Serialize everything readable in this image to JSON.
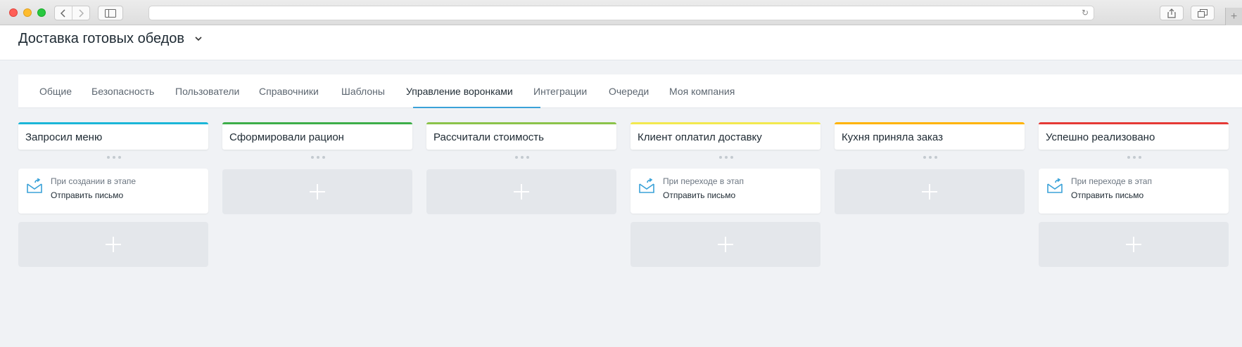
{
  "browser": {
    "buttons": [
      "back",
      "forward",
      "sidebar",
      "reload",
      "share",
      "tabs",
      "new-tab"
    ]
  },
  "app": {
    "title": "Доставка готовых обедов"
  },
  "tabs": [
    {
      "label": "Общие"
    },
    {
      "label": "Безопасность"
    },
    {
      "label": "Пользователи"
    },
    {
      "label": "Справочники"
    },
    {
      "label": "Шаблоны"
    },
    {
      "label": "Управление воронками",
      "active": true
    },
    {
      "label": "Интеграции"
    },
    {
      "label": "Очереди"
    },
    {
      "label": "Моя компания"
    }
  ],
  "stages": [
    {
      "title": "Запросил меню",
      "color": "#1bb6d8",
      "action": {
        "trigger": "При создании в этапе",
        "name": "Отправить письмо",
        "icon": "mail-send-icon"
      }
    },
    {
      "title": "Сформировали рацион",
      "color": "#3dae49",
      "action": null
    },
    {
      "title": "Рассчитали стоимость",
      "color": "#8bc34a",
      "action": null
    },
    {
      "title": "Клиент оплатил доставку",
      "color": "#f2e94e",
      "action": {
        "trigger": "При переходе в этап",
        "name": "Отправить письмо",
        "icon": "mail-send-icon"
      }
    },
    {
      "title": "Кухня приняла заказ",
      "color": "#ffb300",
      "action": null
    },
    {
      "title": "Успешно реализовано",
      "color": "#e53935",
      "action": {
        "trigger": "При переходе в этап",
        "name": "Отправить письмо",
        "icon": "mail-send-icon"
      }
    }
  ]
}
